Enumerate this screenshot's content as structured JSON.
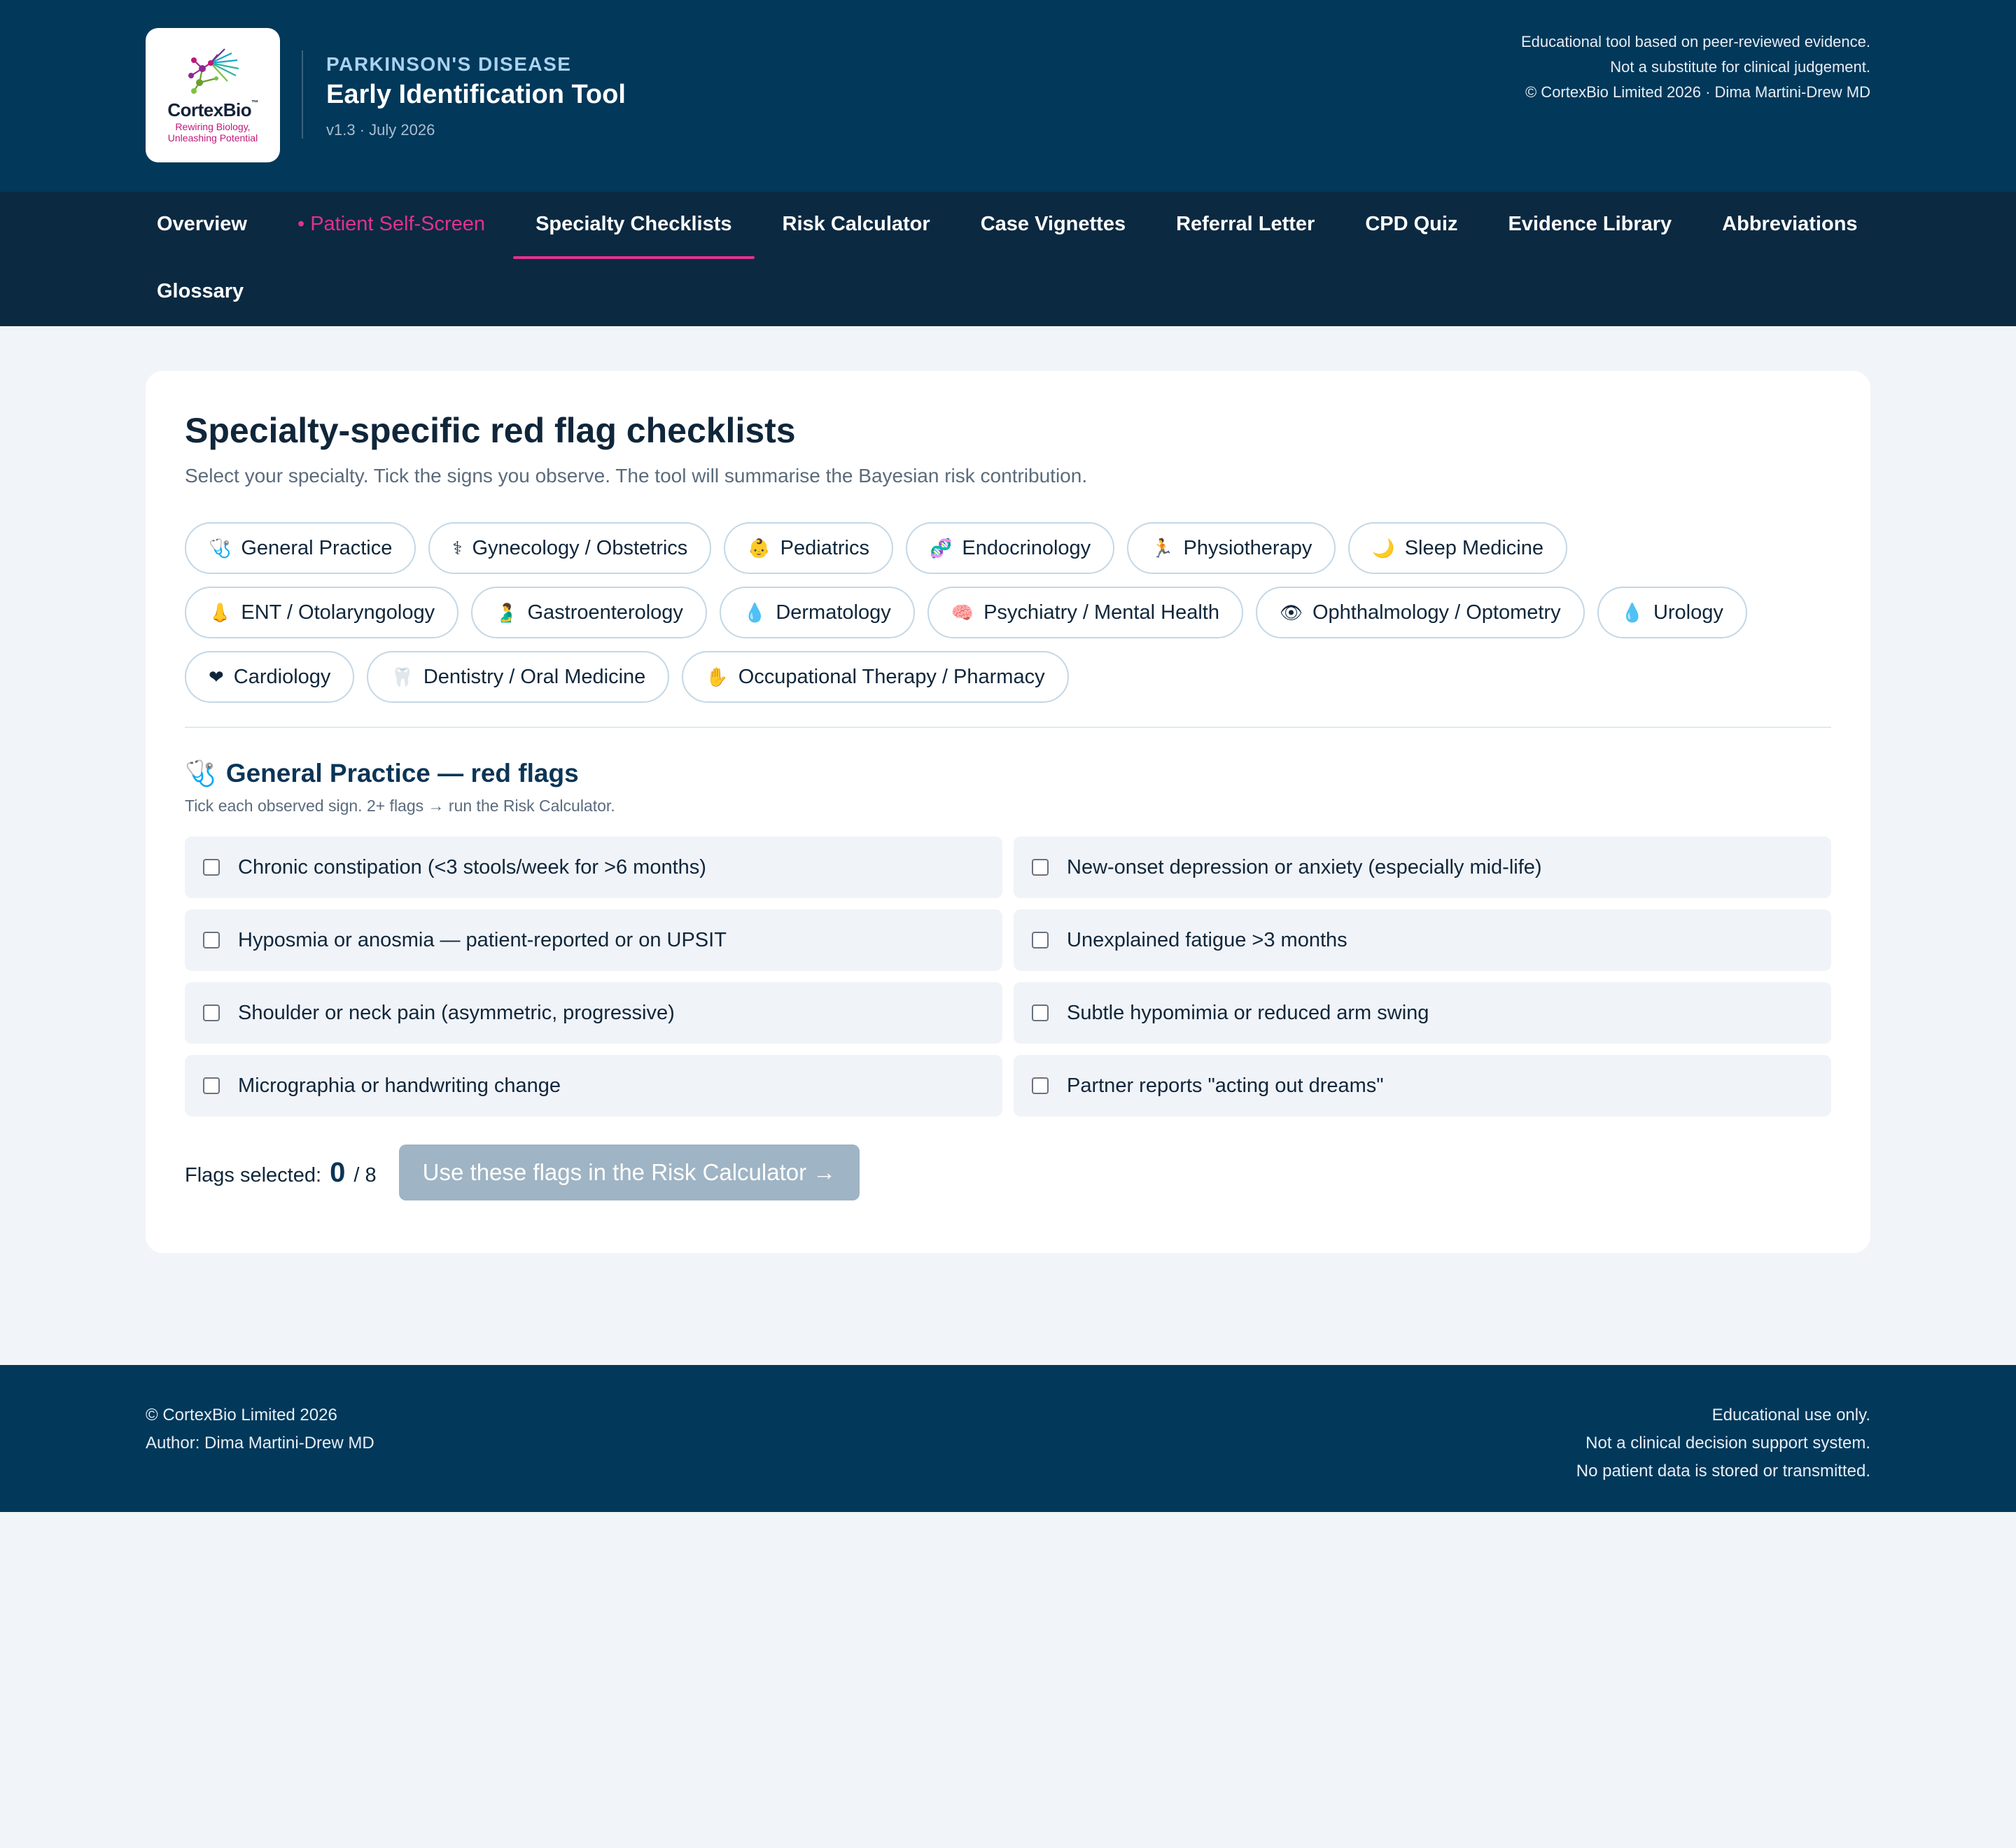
{
  "header": {
    "logo": {
      "name": "CortexBio",
      "trademark": "™",
      "tagline_1": "Rewiring Biology,",
      "tagline_2": "Unleashing Potential"
    },
    "eyebrow": "PARKINSON'S DISEASE",
    "title": "Early Identification Tool",
    "version": "v1.3 · July 2026",
    "disclaimer": [
      "Educational tool based on peer-reviewed evidence.",
      "Not a substitute for clinical judgement.",
      "© CortexBio Limited 2026 · Dima Martini-Drew MD"
    ]
  },
  "nav": {
    "items": [
      {
        "label": "Overview"
      },
      {
        "label": "• Patient Self-Screen"
      },
      {
        "label": "Specialty Checklists"
      },
      {
        "label": "Risk Calculator"
      },
      {
        "label": "Case Vignettes"
      },
      {
        "label": "Referral Letter"
      },
      {
        "label": "CPD Quiz"
      },
      {
        "label": "Evidence Library"
      },
      {
        "label": "Abbreviations"
      },
      {
        "label": "Glossary"
      }
    ],
    "active": "Specialty Checklists",
    "accent_color": "#e0328f"
  },
  "main": {
    "title": "Specialty-specific red flag checklists",
    "subtitle": "Select your specialty. Tick the signs you observe. The tool will summarise the Bayesian risk contribution.",
    "specialties": [
      {
        "icon": "🩺",
        "label": "General Practice"
      },
      {
        "icon": "⚕",
        "label": "Gynecology / Obstetrics"
      },
      {
        "icon": "👶",
        "label": "Pediatrics"
      },
      {
        "icon": "🧬",
        "label": "Endocrinology"
      },
      {
        "icon": "🏃",
        "label": "Physiotherapy"
      },
      {
        "icon": "🌙",
        "label": "Sleep Medicine"
      },
      {
        "icon": "👃",
        "label": "ENT / Otolaryngology"
      },
      {
        "icon": "🫃",
        "label": "Gastroenterology"
      },
      {
        "icon": "💧",
        "label": "Dermatology"
      },
      {
        "icon": "🧠",
        "label": "Psychiatry / Mental Health"
      },
      {
        "icon": "👁",
        "label": "Ophthalmology / Optometry"
      },
      {
        "icon": "💧",
        "label": "Urology"
      },
      {
        "icon": "❤",
        "label": "Cardiology"
      },
      {
        "icon": "🦷",
        "label": "Dentistry / Oral Medicine"
      },
      {
        "icon": "✋",
        "label": "Occupational Therapy / Pharmacy"
      }
    ],
    "section": {
      "icon": "🩺",
      "title": "General Practice — red flags",
      "hint": "Tick each observed sign. 2+ flags → run the Risk Calculator."
    },
    "flags": [
      {
        "label": "Chronic constipation (<3 stools/week for >6 months)",
        "checked": false
      },
      {
        "label": "New-onset depression or anxiety (especially mid-life)",
        "checked": false
      },
      {
        "label": "Hyposmia or anosmia — patient-reported or on UPSIT",
        "checked": false
      },
      {
        "label": "Unexplained fatigue >3 months",
        "checked": false
      },
      {
        "label": "Shoulder or neck pain (asymmetric, progressive)",
        "checked": false
      },
      {
        "label": "Subtle hypomimia or reduced arm swing",
        "checked": false
      },
      {
        "label": "Micrographia or handwriting change",
        "checked": false
      },
      {
        "label": "Partner reports \"acting out dreams\"",
        "checked": false
      }
    ],
    "flags_selected_label": "Flags selected:",
    "flags_selected_count": "0",
    "flags_total": "/ 8",
    "use_button_label": "Use these flags in the Risk Calculator →"
  },
  "footer": {
    "left": [
      "© CortexBio Limited 2026",
      "Author: Dima Martini-Drew MD"
    ],
    "right": [
      "Educational use only.",
      "Not a clinical decision support system.",
      "No patient data is stored or transmitted."
    ]
  }
}
